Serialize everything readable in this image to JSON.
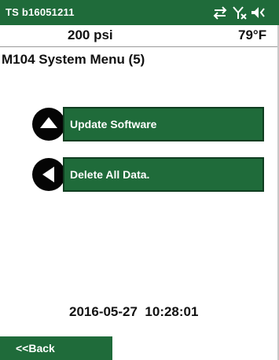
{
  "status_bar": {
    "device_id": "TS b16051211",
    "icons": [
      "data-transfer-icon",
      "no-signal-icon",
      "speaker-muted-icon"
    ],
    "color": "#1f6b3a"
  },
  "readings": {
    "pressure": "200 psi",
    "temperature": "79°F"
  },
  "menu": {
    "title": "M104 System Menu (5)",
    "items": [
      {
        "key": "up-arrow-key-icon",
        "label": "Update Software"
      },
      {
        "key": "left-arrow-key-icon",
        "label": "Delete All Data."
      }
    ]
  },
  "footer": {
    "datetime": "2016-05-27  10:28:01",
    "back_label": "<<Back"
  }
}
